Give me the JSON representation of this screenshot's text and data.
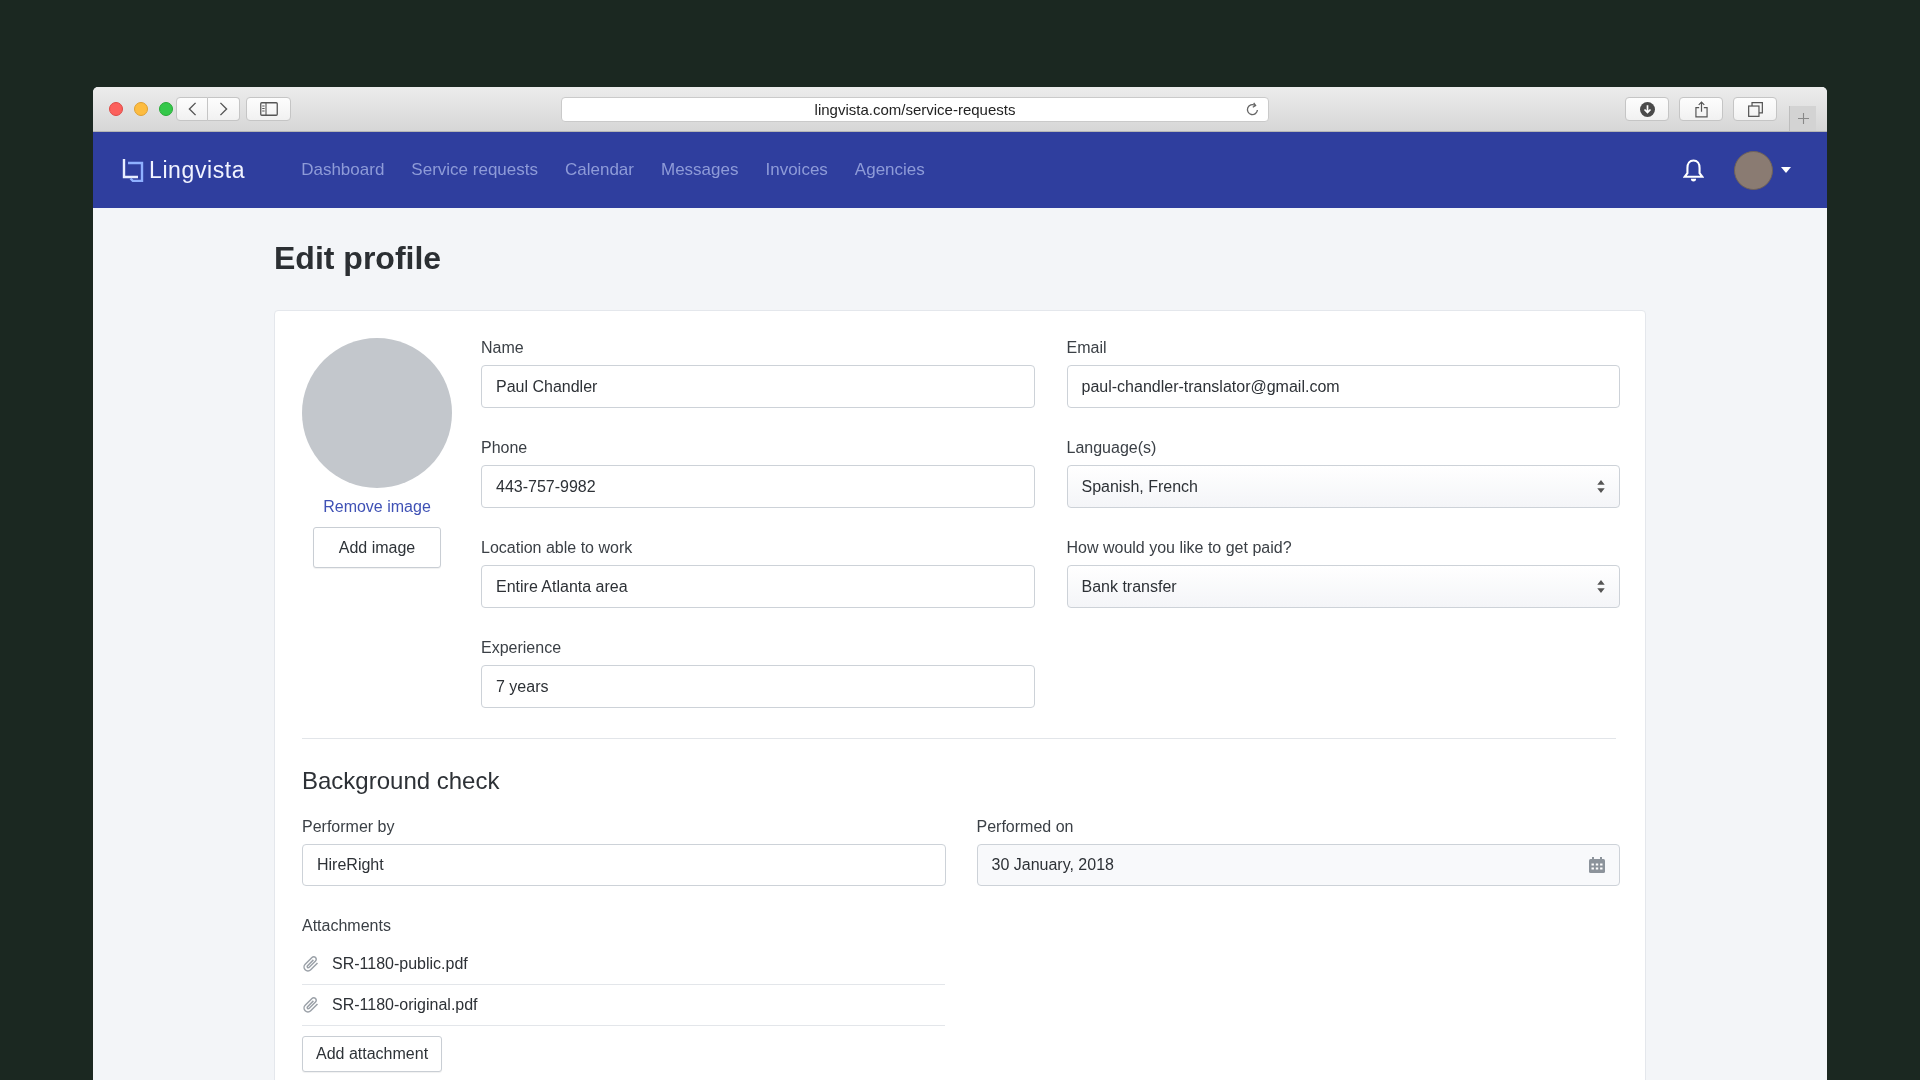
{
  "browser": {
    "url": "lingvista.com/service-requests"
  },
  "navbar": {
    "brand": "Lingvista",
    "items": [
      {
        "label": "Dashboard"
      },
      {
        "label": "Service requests"
      },
      {
        "label": "Calendar"
      },
      {
        "label": "Messages"
      },
      {
        "label": "Invoices"
      },
      {
        "label": "Agencies"
      }
    ]
  },
  "page": {
    "title": "Edit profile"
  },
  "profile": {
    "remove_image": "Remove image",
    "add_image": "Add image",
    "fields": [
      {
        "label": "Name",
        "value": "Paul Chandler",
        "kind": "text"
      },
      {
        "label": "Email",
        "value": "paul-chandler-translator@gmail.com",
        "kind": "text"
      },
      {
        "label": "Phone",
        "value": "443-757-9982",
        "kind": "text"
      },
      {
        "label": "Language(s)",
        "value": "Spanish, French",
        "kind": "select"
      },
      {
        "label": "Location able to work",
        "value": "Entire Atlanta area",
        "kind": "text"
      },
      {
        "label": "How would you like to get paid?",
        "value": "Bank transfer",
        "kind": "select"
      },
      {
        "label": "Experience",
        "value": "7 years",
        "kind": "text"
      }
    ]
  },
  "background_check": {
    "title": "Background check",
    "fields": [
      {
        "label": "Performer by",
        "value": "HireRight",
        "kind": "text"
      },
      {
        "label": "Performed on",
        "value": "30 January, 2018",
        "kind": "date"
      }
    ],
    "attachments_label": "Attachments",
    "attachments": [
      {
        "name": "SR-1180-public.pdf"
      },
      {
        "name": "SR-1180-original.pdf"
      }
    ],
    "add_attachment": "Add attachment"
  }
}
